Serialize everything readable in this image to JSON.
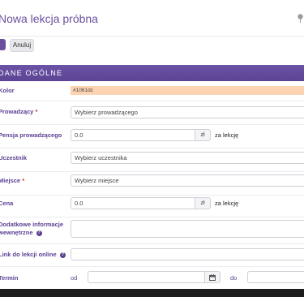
{
  "header": {
    "title": "Nowa lekcja próbna"
  },
  "toolbar": {
    "save_label": "",
    "cancel_label": "Anuluj"
  },
  "section": {
    "title": "DANE OGÓLNE"
  },
  "form": {
    "color": {
      "label": "Kolor",
      "value": "#1061dc",
      "swatch": "#fdd4b3"
    },
    "teacher": {
      "label": "Prowadzący",
      "required_mark": "*",
      "placeholder": "Wybierz prowadzącego"
    },
    "teacher_pay": {
      "label": "Pensja prowadzącego",
      "value": "0.0",
      "currency": "zł",
      "suffix": "za lekcję"
    },
    "student": {
      "label": "Uczestnik",
      "placeholder": "Wybierz uczestnika"
    },
    "place": {
      "label": "Miejsce",
      "required_mark": "*",
      "placeholder": "Wybierz miejsce"
    },
    "price": {
      "label": "Cena",
      "value": "0.0",
      "currency": "zł",
      "suffix": "za lekcję"
    },
    "internal_info": {
      "label_line1": "Dodatkowe informacje",
      "label_line2": "wewnętrzne",
      "value": ""
    },
    "online_link": {
      "label": "Link do lekcji online",
      "value": ""
    },
    "term": {
      "label": "Termin",
      "from_label": "od",
      "to_label": "do",
      "from_value": "",
      "to_value": ""
    }
  },
  "icons": {
    "pin": "pin-icon",
    "help": "help-icon",
    "calendar": "calendar-icon"
  },
  "colors": {
    "accent": "#6a4fa0",
    "section_bar": "#5d4594",
    "label": "#5b3f93",
    "required": "#c0392b"
  }
}
